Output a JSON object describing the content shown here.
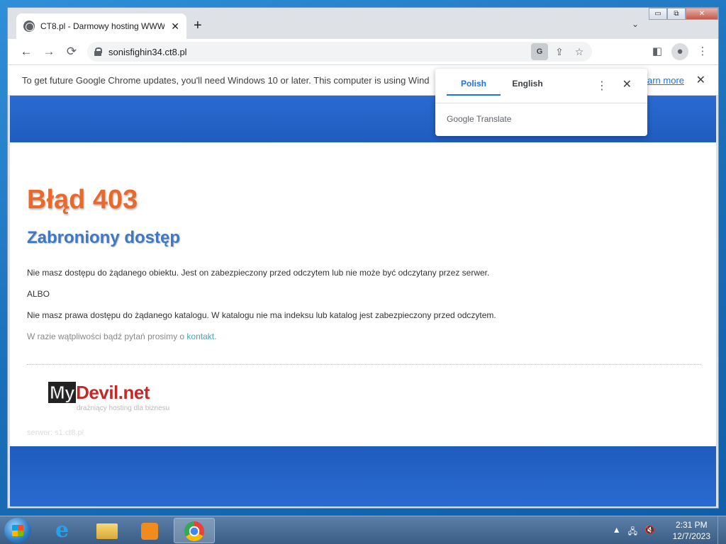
{
  "browser": {
    "tab_title": "CT8.pl - Darmowy hosting WWW",
    "tab_close": "✕",
    "new_tab": "+",
    "tab_search": "⌄",
    "url": "sonisfighin34.ct8.pl",
    "window_controls": {
      "minimize": "▭",
      "restore": "⧉",
      "close": "✕"
    },
    "nav": {
      "back": "←",
      "forward": "→",
      "reload": "⟳"
    },
    "omnibox_icons": {
      "translate": "G",
      "share": "⇪",
      "bookmark": "☆"
    },
    "toolbar_icons": {
      "sidebar": "◧",
      "profile": "●",
      "menu": "⋮"
    }
  },
  "infobar": {
    "message": "To get future Google Chrome updates, you'll need Windows 10 or later. This computer is using Wind",
    "link": "earn more",
    "close": "✕"
  },
  "translate_popup": {
    "source_lang": "Polish",
    "target_lang": "English",
    "menu": "⋮",
    "close": "✕",
    "brand": "Google Translate"
  },
  "page": {
    "error_title": "Błąd 403",
    "error_subtitle": "Zabroniony dostęp",
    "paragraph1": "Nie masz dostępu do żądanego obiektu. Jest on zabezpieczony przed odczytem lub nie może być odczytany przez serwer.",
    "or_text": "ALBO",
    "paragraph2": "Nie masz prawa dostępu do żądanego katalogu. W katalogu nie ma indeksu lub katalog jest zabezpieczony przed odczytem.",
    "contact_prefix": "W razie wątpliwości bądź pytań prosimy o ",
    "contact_link": "kontakt.",
    "logo_my": "My",
    "logo_devil": "Devil.net",
    "logo_tagline": "drażniący hosting dla biznesu",
    "server": "serwer: s1.ct8.pl"
  },
  "taskbar": {
    "tray_arrow": "▲",
    "tray_network": "🖧",
    "tray_volume": "🔇",
    "time": "2:31 PM",
    "date": "12/7/2023"
  }
}
